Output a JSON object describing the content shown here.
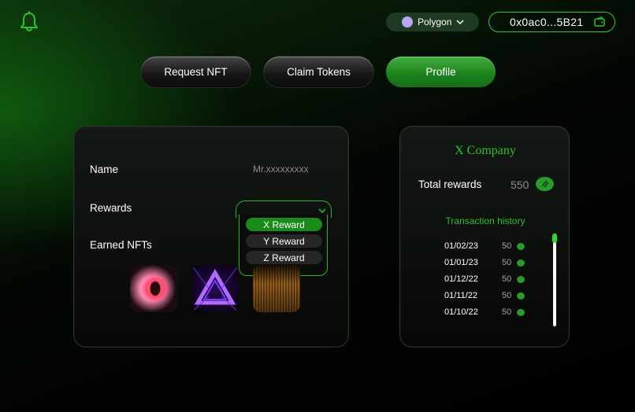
{
  "header": {
    "network": {
      "label": "Polygon",
      "icon": "polygon-icon"
    },
    "wallet": {
      "address": "0x0ac0...5B21",
      "icon": "wallet-icon"
    },
    "notification_icon": "bell-icon"
  },
  "tabs": [
    {
      "label": "Request NFT",
      "active": false
    },
    {
      "label": "Claim Tokens",
      "active": false
    },
    {
      "label": "Profile",
      "active": true
    }
  ],
  "profile": {
    "name_label": "Name",
    "name_value": "Mr.xxxxxxxxx",
    "rewards_label": "Rewards",
    "rewards_options": [
      {
        "label": "X Reward",
        "selected": true
      },
      {
        "label": "Y Reward",
        "selected": false
      },
      {
        "label": "Z Reward",
        "selected": false
      }
    ],
    "earned_nfts_label": "Earned NFTs",
    "nfts": [
      "nft-swirl-pink",
      "nft-triangle-purple",
      "nft-gold-lines"
    ]
  },
  "company": {
    "name": "X Company",
    "total_rewards_label": "Total rewards",
    "total_rewards_value": "550",
    "transaction_history_label": "Transaction history",
    "transactions": [
      {
        "date": "01/02/23",
        "amount": "50"
      },
      {
        "date": "01/01/23",
        "amount": "50"
      },
      {
        "date": "01/12/22",
        "amount": "50"
      },
      {
        "date": "01/11/22",
        "amount": "50"
      },
      {
        "date": "01/10/22",
        "amount": "50"
      }
    ]
  },
  "colors": {
    "accent": "#2fbf2f",
    "card_bg": "#0f120f",
    "muted_text": "#8c8c8c"
  }
}
